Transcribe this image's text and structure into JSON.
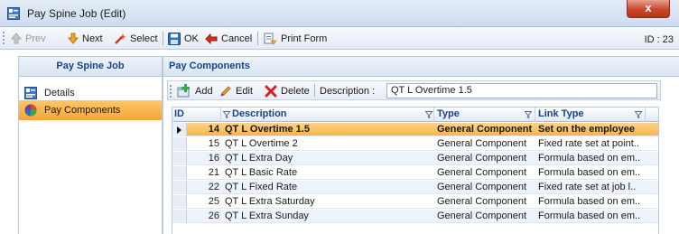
{
  "window": {
    "title": "Pay Spine Job (Edit)",
    "close_label": "x"
  },
  "toolbar": {
    "prev_label": "Prev",
    "next_label": "Next",
    "select_label": "Select",
    "ok_label": "OK",
    "cancel_label": "Cancel",
    "print_label": "Print Form",
    "record_id": "ID : 23"
  },
  "sidebar": {
    "header": "Pay Spine Job",
    "items": [
      {
        "label": "Details",
        "icon": "form-icon",
        "selected": false
      },
      {
        "label": "Pay Components",
        "icon": "components-icon",
        "selected": true
      }
    ]
  },
  "main": {
    "header": "Pay Components",
    "sub_toolbar": {
      "add_label": "Add",
      "edit_label": "Edit",
      "delete_label": "Delete",
      "description_label": "Description :",
      "description_value": "QT L Overtime 1.5"
    },
    "grid": {
      "columns": [
        "ID",
        "Description",
        "Type",
        "Link Type"
      ],
      "rows": [
        {
          "id": "14",
          "description": "QT L Overtime 1.5",
          "type": "General Component",
          "link_type": "Set on the employee",
          "current": true
        },
        {
          "id": "15",
          "description": "QT L Overtime 2",
          "type": "General Component",
          "link_type": "Fixed rate set at point.."
        },
        {
          "id": "16",
          "description": "QT L Extra Day",
          "type": "General Component",
          "link_type": "Formula based on em.."
        },
        {
          "id": "21",
          "description": "QT L Basic Rate",
          "type": "General Component",
          "link_type": "Formula based on em.."
        },
        {
          "id": "22",
          "description": "QT L Fixed Rate",
          "type": "General Component",
          "link_type": "Fixed rate set at job l.."
        },
        {
          "id": "25",
          "description": "QT L Extra Saturday",
          "type": "General Component",
          "link_type": "Formula based on em.."
        },
        {
          "id": "26",
          "description": "QT L Extra Sunday",
          "type": "General Component",
          "link_type": "Formula based on em.."
        }
      ]
    }
  },
  "colors": {
    "accent_orange": "#f6a633",
    "header_blue": "#15428b",
    "delete_red": "#d42020",
    "ok_blue": "#2a6fc9"
  }
}
